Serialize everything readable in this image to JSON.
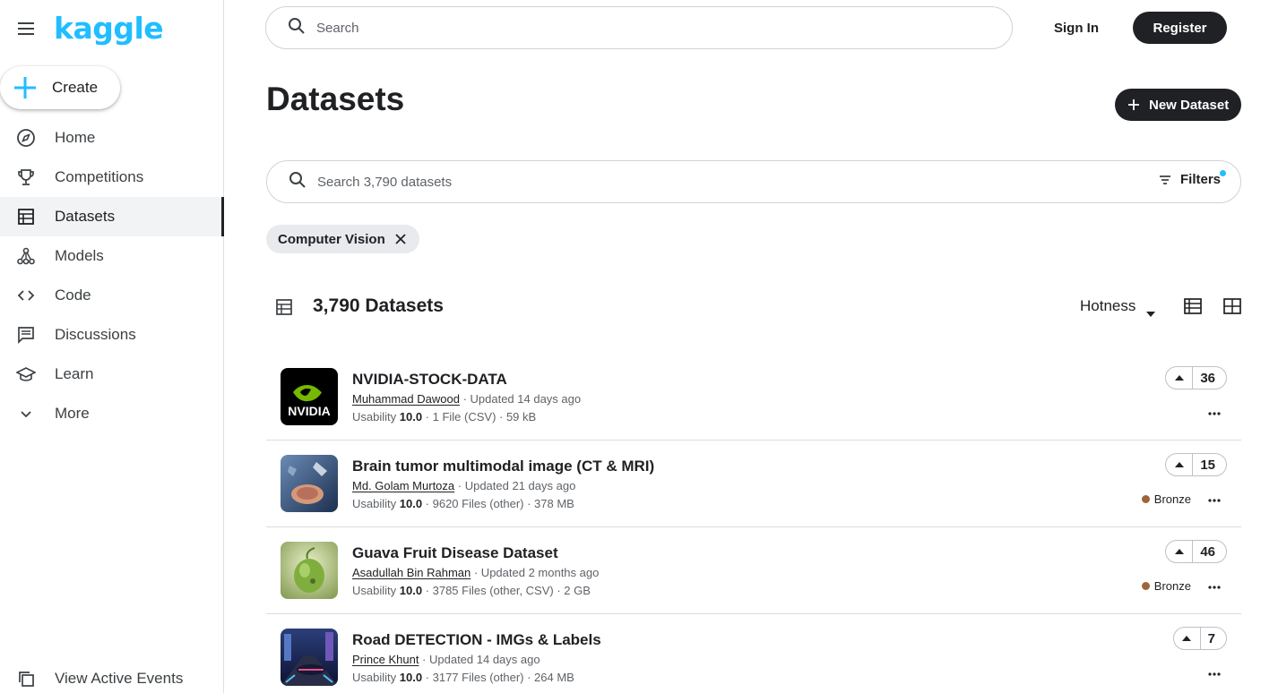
{
  "brand": {
    "logo": "kaggle",
    "accent": "#20beff"
  },
  "sidebar": {
    "create_label": "Create",
    "items": [
      {
        "label": "Home",
        "icon": "compass-icon"
      },
      {
        "label": "Competitions",
        "icon": "trophy-icon"
      },
      {
        "label": "Datasets",
        "icon": "table-icon",
        "active": true
      },
      {
        "label": "Models",
        "icon": "models-icon"
      },
      {
        "label": "Code",
        "icon": "code-icon"
      },
      {
        "label": "Discussions",
        "icon": "discussions-icon"
      },
      {
        "label": "Learn",
        "icon": "learn-icon"
      },
      {
        "label": "More",
        "icon": "chevron-down-icon"
      }
    ],
    "view_active_events": "View Active Events"
  },
  "header": {
    "search_placeholder": "Search",
    "sign_in": "Sign In",
    "register": "Register"
  },
  "page": {
    "title": "Datasets",
    "new_dataset": "New Dataset",
    "dataset_search_placeholder": "Search 3,790 datasets",
    "filters_label": "Filters",
    "active_chip": "Computer Vision",
    "count_label": "3,790 Datasets",
    "sort_label": "Hotness"
  },
  "datasets": [
    {
      "title": "NVIDIA-STOCK-DATA",
      "author": "Muhammad Dawood",
      "updated": " · Updated 14 days ago",
      "usability_label": "Usability ",
      "usability": "10.0",
      "details": " · 1 File (CSV) · 59 kB",
      "votes": "36",
      "medal": ""
    },
    {
      "title": "Brain tumor multimodal image (CT & MRI)",
      "author": "Md. Golam Murtoza",
      "updated": " · Updated 21 days ago",
      "usability_label": "Usability ",
      "usability": "10.0",
      "details": " · 9620 Files (other) · 378 MB",
      "votes": "15",
      "medal": "Bronze"
    },
    {
      "title": "Guava Fruit Disease Dataset",
      "author": "Asadullah Bin Rahman",
      "updated": " · Updated 2 months ago",
      "usability_label": "Usability ",
      "usability": "10.0",
      "details": " · 3785 Files (other, CSV) · 2 GB",
      "votes": "46",
      "medal": "Bronze"
    },
    {
      "title": "Road DETECTION - IMGs & Labels",
      "author": "Prince Khunt",
      "updated": " · Updated 14 days ago",
      "usability_label": "Usability ",
      "usability": "10.0",
      "details": " · 3177 Files (other) · 264 MB",
      "votes": "7",
      "medal": ""
    }
  ]
}
